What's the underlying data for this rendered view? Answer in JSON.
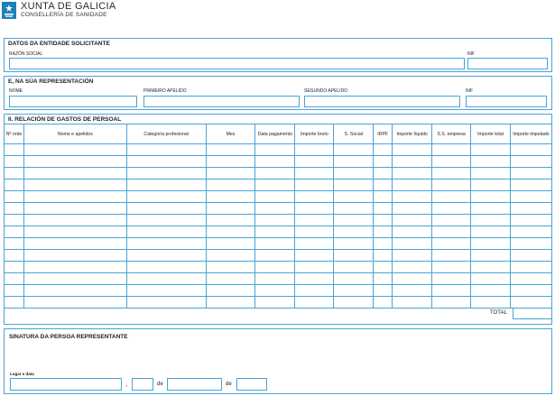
{
  "header": {
    "org_name": "XUNTA DE GALICIA",
    "department": "CONSELLERÍA DE SANIDADE",
    "brand_color": "#1f7fb8"
  },
  "section_entity": {
    "title": "DATOS DA ENTIDADE SOLICITANTE",
    "razon_social_label": "RAZÓN SOCIAL",
    "nif_label": "NIF"
  },
  "section_representation": {
    "title": "E, NA SÚA REPRESENTACIÓN",
    "nome_label": "NOME",
    "primeiro_apelido_label": "PRIMEIRO APELIDO",
    "segundo_apelido_label": "SEGUNDO APELIDO",
    "nif_label": "NIF"
  },
  "section_expenses": {
    "title": "II. RELACIÓN DE GASTOS DE PERSOAL",
    "columns": [
      "Nº orde",
      "Nome e apelidos",
      "Categoría profesional",
      "Mes",
      "Data pagamento",
      "Importe bruto",
      "S. Social",
      "IRPF",
      "Importe líquido",
      "S.S. empresa",
      "Importe total",
      "Importe imputado"
    ],
    "empty_row_count": 14,
    "total_label": "TOTAL"
  },
  "section_signature": {
    "title": "SINATURA DA PERSOA REPRESENTANTE",
    "place_date_label": "Lugar e data",
    "comma": ",",
    "de_1": "de",
    "de_2": "de"
  },
  "accent_color": "#4aa3d8"
}
